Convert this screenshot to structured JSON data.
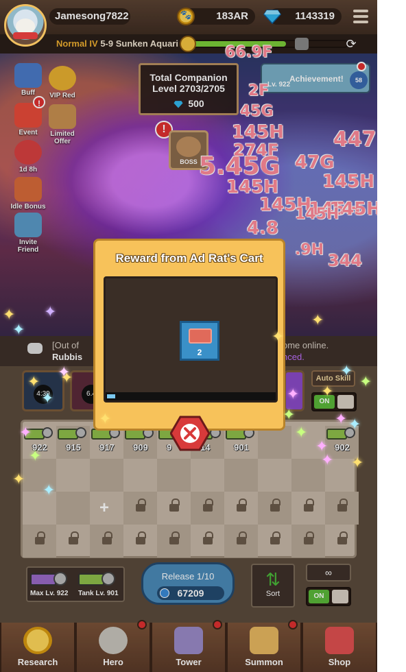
{
  "header": {
    "username": "Jamesong7822",
    "gold": "183AR",
    "gems": "1143319"
  },
  "stage": {
    "mode": "Normal IV",
    "name": "5-9 Sunken Aquari",
    "progress": 0.62
  },
  "companion": {
    "line1": "Total Companion",
    "line2": "Level 2703/2705",
    "reward": "500"
  },
  "achievement": {
    "label": "Achievement!",
    "lv": "Lv. 922",
    "badge": "58"
  },
  "side_menu": {
    "buff": "Buff",
    "vip": "VIP Red",
    "event": "Event",
    "limited": "Limited Offer",
    "timer": "1d 8h",
    "idle": "Idle Bonus",
    "invite": "Invite Friend",
    "boss": "BOSS"
  },
  "damage_numbers": [
    "66.9F",
    "2F",
    "45G",
    "145H",
    "274F",
    "5.45G",
    "47G",
    "145H",
    "447",
    "145H",
    "145H",
    "145H",
    "145H",
    "4.8",
    "145H",
    ".9H",
    "344"
  ],
  "chat": {
    "line1": "[Out of",
    "line2": "Rubbis",
    "line3": "ome online.",
    "line4": "nced."
  },
  "skills": {
    "slot1": "4:39",
    "slot2": "6.4",
    "auto_skill": "Auto Skill",
    "toggle_on": "ON"
  },
  "carts": {
    "levels": [
      "922",
      "915",
      "917",
      "909",
      "9",
      "14",
      "901",
      "902"
    ]
  },
  "bottom": {
    "max_lv": "Max Lv. 922",
    "tank_lv": "Tank Lv. 901",
    "release_title": "Release 1/10",
    "release_cost": "67209",
    "sort": "Sort",
    "infinity": "∞",
    "toggle_on": "ON"
  },
  "nav": {
    "research": "Research",
    "hero": "Hero",
    "tower": "Tower",
    "summon": "Summon",
    "shop": "Shop"
  },
  "modal": {
    "title": "Reward from Ad Rat's Cart",
    "item_count": "2",
    "progress": 0.05
  },
  "colors": {
    "modal_bg": "#f7c25a",
    "accent_green": "#7ccd3a",
    "alert_red": "#e03030"
  }
}
